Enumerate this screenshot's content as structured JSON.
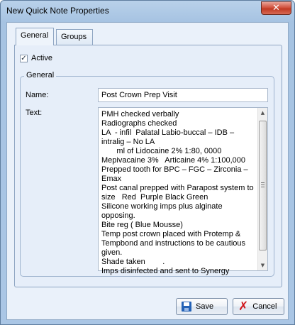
{
  "window": {
    "title": "New Quick Note Properties",
    "close_glyph": "✕"
  },
  "tabs": [
    {
      "label": "General",
      "active": true
    },
    {
      "label": "Groups",
      "active": false
    }
  ],
  "general_tab": {
    "active_checkbox": {
      "label": "Active",
      "checked": true,
      "glyph": "✓"
    },
    "group_title": "General",
    "name_label": "Name:",
    "name_value": "Post Crown Prep Visit",
    "text_label": "Text:",
    "text_value": "PMH checked verbally\nRadiographs checked\nLA  - infil  Palatal Labio-buccal – IDB –\nintralig – No LA\n       ml of Lidocaine 2% 1:80, 0000\nMepivacaine 3%   Articaine 4% 1:100,000\nPrepped tooth for BPC – FGC – Zirconia –\nEmax\nPost canal prepped with Parapost system to\nsize   Red  Purple Black Green\nSilicone working imps plus alginate opposing.\nBite reg ( Blue Mousse)\nTemp post crown placed with Protemp &\nTempbond and instructions to be cautious\ngiven.\nShade taken        .\nImps disinfected and sent to Synergy"
  },
  "scrollbar": {
    "up_glyph": "▲",
    "down_glyph": "▼"
  },
  "buttons": {
    "save_label": "Save",
    "cancel_label": "Cancel",
    "cancel_glyph": "✗"
  },
  "colors": {
    "titlebar": "#b9d1ea",
    "close_button": "#c13a24",
    "save_icon": "#2462b6",
    "cancel_icon": "#d0161b"
  }
}
